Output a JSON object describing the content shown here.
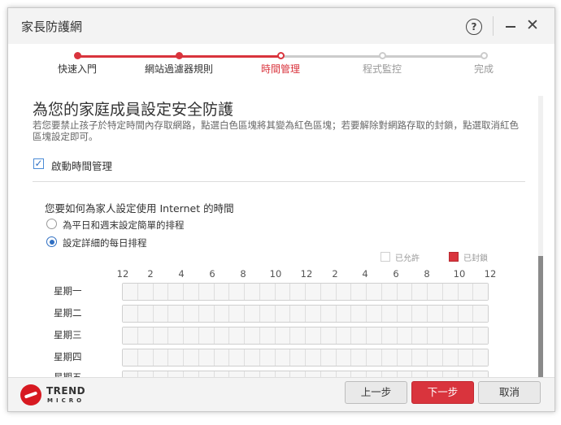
{
  "window": {
    "title": "家長防護網"
  },
  "titlebar": {
    "help_glyph": "?",
    "close_glyph": "✕"
  },
  "steps": [
    {
      "label": "快速入門",
      "state": "done"
    },
    {
      "label": "網站過濾器規則",
      "state": "done"
    },
    {
      "label": "時間管理",
      "state": "current"
    },
    {
      "label": "程式監控",
      "state": "pending"
    },
    {
      "label": "完成",
      "state": "pending"
    }
  ],
  "content": {
    "heading": "為您的家庭成員設定安全防護",
    "description": "若您要禁止孩子於特定時間內存取網路，點選白色區塊將其變為紅色區塊；若要解除對網路存取的封鎖，點選取消紅色區塊設定即可。",
    "enable_checkbox_label": "啟動時間管理",
    "enable_checked": true,
    "question": "您要如何為家人設定使用 Internet 的時間",
    "options": [
      {
        "label": "為平日和週末設定簡單的排程",
        "selected": false
      },
      {
        "label": "設定詳細的每日排程",
        "selected": true
      }
    ]
  },
  "schedule": {
    "legend_allowed": "已允許",
    "legend_blocked": "已封鎖",
    "hours": [
      "12",
      "2",
      "4",
      "6",
      "8",
      "10",
      "12",
      "2",
      "4",
      "6",
      "8",
      "10",
      "12"
    ],
    "days": [
      "星期一",
      "星期二",
      "星期三",
      "星期四",
      "星期五"
    ]
  },
  "colors": {
    "accent": "#d9343d",
    "step_done": "#d9343d",
    "step_pending": "#cccccc"
  },
  "footer": {
    "brand_top": "TREND",
    "brand_bottom": "MICRO",
    "prev_button": "上一步",
    "next_button": "下一步",
    "cancel_button": "取消"
  }
}
